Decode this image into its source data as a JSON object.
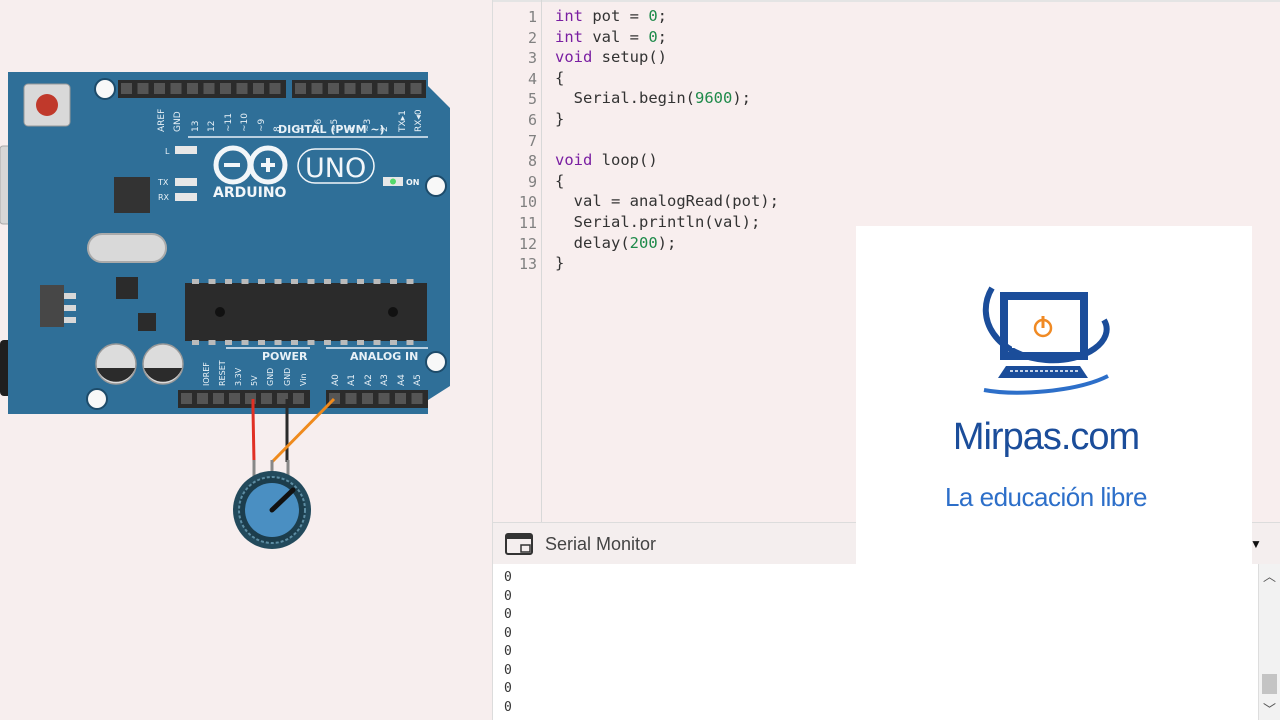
{
  "circuit": {
    "board_brand": "ARDUINO",
    "board_model": "UNO",
    "on_label": "ON",
    "digital_label": "DIGITAL (PWM ~)",
    "power_label": "POWER",
    "analog_label": "ANALOG IN",
    "led_labels": [
      "L",
      "TX",
      "RX"
    ],
    "digital_pins": [
      "AREF",
      "GND",
      "13",
      "12",
      "~11",
      "~10",
      "~9",
      "8",
      "7",
      "~6",
      "~5",
      "4",
      "~3",
      "2",
      "TX▸1",
      "RX◂0"
    ],
    "power_pins": [
      "IOREF",
      "RESET",
      "3.3V",
      "5V",
      "GND",
      "GND",
      "Vin"
    ],
    "analog_pins": [
      "A0",
      "A1",
      "A2",
      "A3",
      "A4",
      "A5"
    ],
    "colors": {
      "board": "#2f6f98",
      "wire_5v": "#e03024",
      "wire_gnd": "#2a2a2a",
      "wire_signal": "#ef8a1c",
      "pot_knob": "#4a8fc2"
    }
  },
  "editor": {
    "lines": [
      {
        "n": "1",
        "html": "<span class='kw'>int</span> pot = <span class='num'>0</span>;"
      },
      {
        "n": "2",
        "html": "<span class='kw'>int</span> val = <span class='num'>0</span>;"
      },
      {
        "n": "3",
        "html": "<span class='kw'>void</span> setup()"
      },
      {
        "n": "4",
        "html": "{"
      },
      {
        "n": "5",
        "html": "  Serial.begin(<span class='num'>9600</span>);"
      },
      {
        "n": "6",
        "html": "}"
      },
      {
        "n": "7",
        "html": ""
      },
      {
        "n": "8",
        "html": "<span class='kw'>void</span> loop()"
      },
      {
        "n": "9",
        "html": "{"
      },
      {
        "n": "10",
        "html": "  val = analogRead(pot);"
      },
      {
        "n": "11",
        "html": "  Serial.println(val);"
      },
      {
        "n": "12",
        "html": "  delay(<span class='num'>200</span>);"
      },
      {
        "n": "13",
        "html": "}"
      }
    ]
  },
  "serial_monitor": {
    "title": "Serial Monitor",
    "dropdown_icon": "caret-down-icon",
    "output": [
      "0",
      "0",
      "0",
      "0",
      "0",
      "0",
      "0",
      "0"
    ]
  },
  "logo": {
    "name": "Mirpas.com",
    "tagline": "La educación libre",
    "colors": {
      "primary": "#1b4d9a",
      "accent": "#2d6fc9",
      "power": "#f08a24"
    }
  }
}
